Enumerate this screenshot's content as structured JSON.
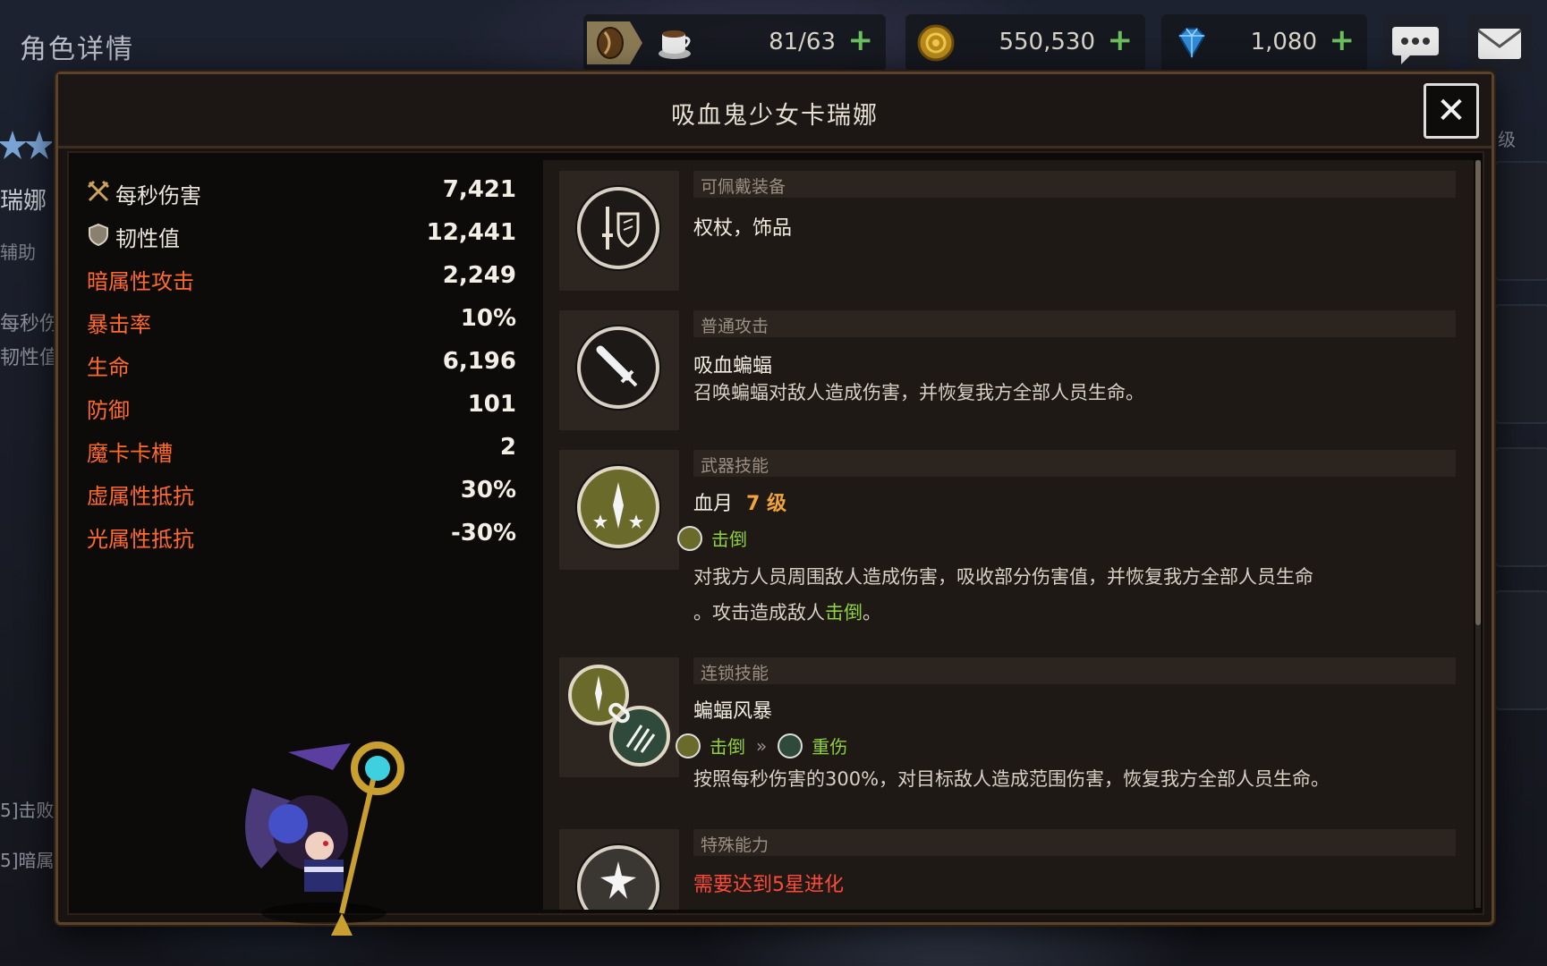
{
  "page": {
    "title": "角色详情"
  },
  "resources": {
    "stamina": {
      "value": "81/63",
      "plus": "+",
      "icon": "coffee-cup-icon"
    },
    "gold": {
      "value": "550,530",
      "plus": "+",
      "icon": "gold-coin-icon"
    },
    "gems": {
      "value": "1,080",
      "plus": "+",
      "icon": "diamond-icon"
    }
  },
  "top_buttons": {
    "chat_icon": "chat-bubble-icon",
    "mail_icon": "mail-icon"
  },
  "background_left": {
    "name_partial": "瑞娜",
    "role_partial": "辅助",
    "stat1_partial": "每秒伤",
    "stat2_partial": "韧性值",
    "note1": "5]击败",
    "note2": "5]暗属"
  },
  "background_right": {
    "level_partial": "级"
  },
  "modal": {
    "title": "吸血鬼少女卡瑞娜",
    "close_label": "✕",
    "stats": [
      {
        "label": "每秒伤害",
        "value": "7,421",
        "icon": "crossed-swords-icon",
        "color": "#e9e5dc"
      },
      {
        "label": "韧性值",
        "value": "12,441",
        "icon": "shield-icon",
        "color": "#e9e5dc"
      },
      {
        "label": "暗属性攻击",
        "value": "2,249",
        "color": "#ff6a2c"
      },
      {
        "label": "暴击率",
        "value": "10%",
        "color": "#ff6a2c"
      },
      {
        "label": "生命",
        "value": "6,196",
        "color": "#ff6a2c"
      },
      {
        "label": "防御",
        "value": "101",
        "color": "#ff6a2c"
      },
      {
        "label": "魔卡卡槽",
        "value": "2",
        "color": "#ff6a2c"
      },
      {
        "label": "虚属性抵抗",
        "value": "30%",
        "color": "#ff6a2c"
      },
      {
        "label": "光属性抵抗",
        "value": "-30%",
        "color": "#ff6a2c"
      }
    ],
    "sections": {
      "equipment": {
        "header": "可佩戴装备",
        "name": "权杖，饰品",
        "icon": "sword-shield-icon"
      },
      "basic_attack": {
        "header": "普通攻击",
        "name": "吸血蝙蝠",
        "desc": "召唤蝙蝠对敌人造成伤害，并恢复我方全部人员生命。",
        "icon": "sword-icon"
      },
      "weapon_skill": {
        "header": "武器技能",
        "name": "血月",
        "level": "7 级",
        "tag": "击倒",
        "desc_line1": "对我方人员周围敌人造成伤害，吸收部分伤害值，并恢复我方全部人员生命",
        "desc_line2_pre": "。攻击造成敌人",
        "desc_line2_hl": "击倒",
        "desc_line2_post": "。",
        "icon": "star-burst-icon"
      },
      "chain_skill": {
        "header": "连锁技能",
        "name": "蝙蝠风暴",
        "tag_from": "击倒",
        "tag_arrow": "»",
        "tag_to": "重伤",
        "desc": "按照每秒伤害的300%，对目标敌人造成范围伤害，恢复我方全部人员生命。",
        "icon": "chain-link-icon"
      },
      "special": {
        "header": "特殊能力",
        "requirement": "需要达到5星进化",
        "icon": "stars-icon"
      }
    }
  },
  "colors": {
    "accent_orange": "#ff6a2c",
    "green": "#8fd13f",
    "level_orange": "#f2a33a",
    "red": "#ff4a3a",
    "frame": "#5b4329"
  }
}
